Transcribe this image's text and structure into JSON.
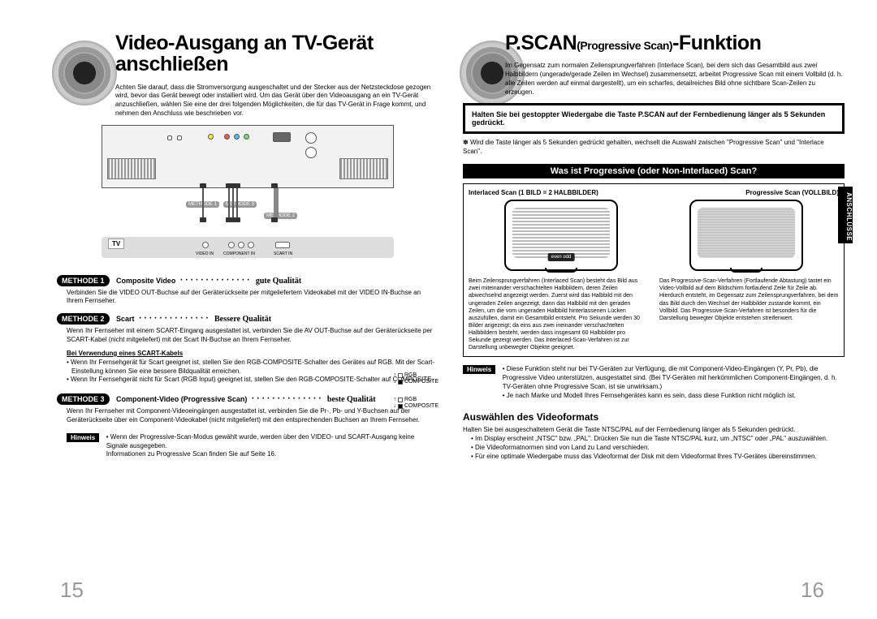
{
  "left": {
    "title": "Video-Ausgang an TV-Gerät anschließen",
    "intro": "Achten Sie darauf, dass die Stromversorgung ausgeschaltet und der Stecker aus der Netzsteckdose gezogen wird, bevor das Gerät bewegt oder installiert wird. Um das Gerät über den Videoausgang an ein TV-Gerät anzuschließen, wählen Sie eine der drei folgenden Möglichkeiten, die für das TV-Gerät in Frage kommt, und nehmen den Anschluss wie beschrieben vor.",
    "diagram": {
      "tv_label": "TV",
      "m1": "METHODE 1",
      "m2": "METHODE 2",
      "m3": "METHODE 3",
      "ports": {
        "video": "VIDEO IN",
        "component": "COMPONENT IN",
        "scart": "SCART IN"
      },
      "legend": {
        "rgb": "RGB",
        "composite": "COMPOSITE"
      }
    },
    "method1": {
      "tag": "METHODE 1",
      "title": "Composite Video",
      "quality": "gute Qualität",
      "body": "Verbinden Sie die VIDEO OUT-Buchse auf der Geräterückseite per mitgeliefertem Videokabel mit der VIDEO IN-Buchse an Ihrem Fernseher."
    },
    "method2": {
      "tag": "METHODE 2",
      "title": "Scart",
      "quality": "Bessere Qualität",
      "body": "Wenn Ihr Fernseher mit einem SCART-Eingang ausgestattet ist, verbinden Sie die AV OUT-Buchse auf der Geräterückseite per SCART-Kabel (nicht mitgeliefert) mit der Scart IN-Buchse an Ihrem Fernseher.",
      "sub": "Bei Verwendung eines SCART-Kabels",
      "b1": "• Wenn Ihr Fernsehgerät für Scart geeignet ist, stellen Sie den RGB-COMPOSITE-Schalter des Gerätes auf RGB. Mit der Scart-Einstellung können Sie eine bessere Bildqualität erreichen.",
      "b2": "• Wenn Ihr Fernsehgerät nicht für Scart (RGB Input) geeignet ist, stellen Sie den RGB-COMPOSITE-Schalter auf COMPOSITE."
    },
    "method3": {
      "tag": "METHODE 3",
      "title": "Component-Video (Progressive Scan)",
      "quality": "beste Qualität",
      "body": "Wenn Ihr Fernseher mit Component-Videoeingängen ausgestattet ist, verbinden Sie die Pr-, Pb- und Y-Buchsen auf der Geräterückseite über ein Component-Videokabel (nicht mitgeliefert) mit den entsprechenden Buchsen an Ihrem Fernseher."
    },
    "note": {
      "tag": "Hinweis",
      "b1": "• Wenn der Progressive-Scan-Modus gewählt wurde, werden über den VIDEO- und SCART-Ausgang keine Signale ausgegeben.",
      "b2": "Informationen zu Progressive Scan finden Sie auf Seite 16."
    },
    "pagenum": "15"
  },
  "right": {
    "title_pre": "P.SCAN",
    "title_small": "(Progressive Scan)",
    "title_post": "-Funktion",
    "intro": "Im Gegensatz zum normalen Zeilensprungverfahren (Interlace Scan), bei dem sich das Gesamtbild aus zwei Halbbildern (ungerade/gerade Zeilen im Wechsel) zusammensetzt, arbeitet Progressive Scan mit einem Vollbild (d. h. alle Zeilen werden auf einmal dargestellt), um ein scharfes, detailreiches Bild ohne sichtbare Scan-Zeilen zu erzeugen.",
    "hold": "Halten Sie bei gestoppter Wiedergabe die Taste P.SCAN auf der Fernbedienung länger als 5 Sekunden gedrückt.",
    "hold_bullet": "Wird die Taste länger als 5 Sekunden gedrückt gehalten, wechselt die Auswahl zwischen \"Progressive Scan\" und \"Interlace Scan\".",
    "blackbar": "Was ist Progressive (oder Non-Interlaced) Scan?",
    "hdr_left": "Interlaced Scan (1 BILD = 2 HALBBILDER)",
    "hdr_right": "Progressive Scan (VOLLBILD)",
    "badge": "even\nodd",
    "desc_left": "Beim Zeilensprungverfahren (Interlaced Scan) besteht das Bild aus zwei miteinander verschachtelten Halbbildern, deren Zeilen abwechselnd angezeigt werden. Zuerst wird das Halbbild mit den ungeraden Zeilen angezeigt, dann das Halbbild mit den geraden Zeilen, um die vom ungeraden Halbbild hinterlassenen Lücken auszufüllen, damit ein Gesamtbild entsteht. Pro Sekunde werden 30 Bilder angezeigt; da eins aus zwei ineinander verschachtelten Halbbildern besteht, werden dass insgesamt 60 Halbbilder pro Sekunde gezeigt werden. Das Interlaced-Scan-Verfahren ist zur Darstellung unbewegter Objekte geeignet.",
    "desc_right": "Das Progressive-Scan-Verfahren (Fortlaufende Abtastung) tastet ein Video-Vollbild auf dem Bildschirm fortlaufend Zeile für Zeile ab. Hierdurch entsteht, im Gegensatz zum Zeilensprungverfahren, bei dem das Bild durch den Wechsel der Halbbilder zustande kommt, ein Vollbild. Das Progressive-Scan-Verfahren ist besonders für die Darstellung bewegter Objekte entstehen streifenwert.",
    "note2": {
      "tag": "Hinweis",
      "b1": "• Diese Funktion steht nur bei TV-Geräten zur Verfügung, die mit Component-Video-Eingängen (Y, Pr, Pb), die Progressive Video unterstützen, ausgestattet sind. (Bei TV-Geräten mit herkömmlichen Component-Eingängen, d. h. TV-Geräten ohne Progressive Scan, ist sie unwirksam.)",
      "b2": "• Je nach Marke und Modell Ihres Fernsehgerätes kann es sein, dass diese Funktion nicht möglich ist."
    },
    "videoformat": {
      "title": "Auswählen des Videoformats",
      "intro": "Halten Sie bei ausgeschaltetem Gerät die Taste NTSC/PAL auf der Fernbedienung länger als 5 Sekunden gedrückt.",
      "b1": "• Im Display erscheint „NTSC\" bzw. „PAL\". Drücken Sie nun die Taste NTSC/PAL kurz, um „NTSC\" oder „PAL\" auszuwählen.",
      "b2": "• Die Videoformatnormen sind von Land zu Land verschieden.",
      "b3": "• Für eine optimale Wiedergabe muss das Videoformat der Disk mit dem Videoformat Ihres TV-Gerätes übereinstimmen."
    },
    "pagenum": "16",
    "sidetab": "ANSCHLÜSSE"
  }
}
